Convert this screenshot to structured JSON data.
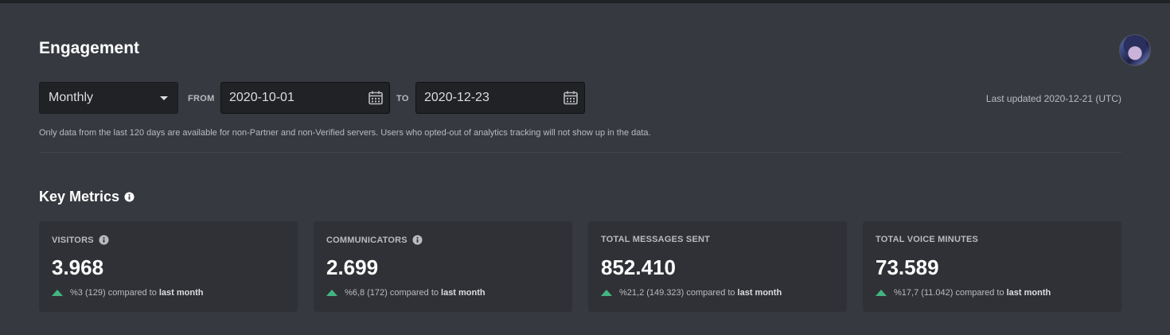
{
  "header": {
    "title": "Engagement"
  },
  "filters": {
    "interval": "Monthly",
    "from_label": "FROM",
    "from_value": "2020-10-01",
    "to_label": "TO",
    "to_value": "2020-12-23"
  },
  "last_updated": "Last updated 2020-12-21 (UTC)",
  "notice": "Only data from the last 120 days are available for non-Partner and non-Verified servers. Users who opted-out of analytics tracking will not show up in the data.",
  "key_metrics": {
    "title": "Key Metrics",
    "cards": [
      {
        "label": "VISITORS",
        "value": "3.968",
        "change": "%3 (129) compared to",
        "period": "last month"
      },
      {
        "label": "COMMUNICATORS",
        "value": "2.699",
        "change": "%6,8 (172) compared to",
        "period": "last month"
      },
      {
        "label": "TOTAL MESSAGES SENT",
        "value": "852.410",
        "change": "%21,2 (149.323) compared to",
        "period": "last month"
      },
      {
        "label": "TOTAL VOICE MINUTES",
        "value": "73.589",
        "change": "%17,7 (11.042) compared to",
        "period": "last month"
      }
    ]
  },
  "colors": {
    "background": "#36393f",
    "card": "#2f3136",
    "input": "#202225",
    "positive": "#43b581"
  },
  "icons": [
    "calendar-icon",
    "info-icon",
    "trend-up-icon",
    "dropdown-caret-icon",
    "user-avatar"
  ]
}
